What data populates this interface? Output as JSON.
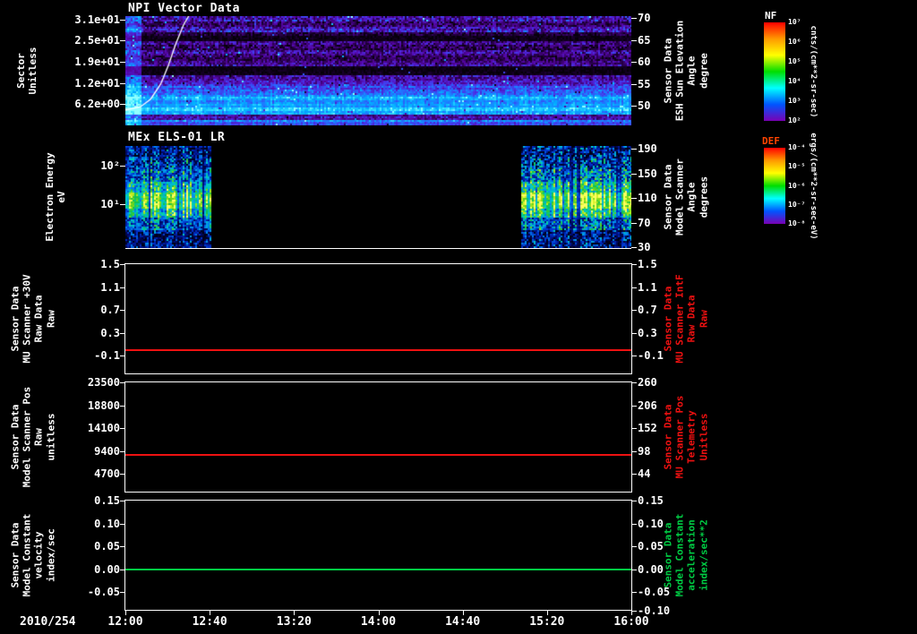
{
  "xaxis": {
    "date_label": "2010/254",
    "tick_labels": [
      "12:00",
      "12:40",
      "13:20",
      "14:00",
      "14:40",
      "15:20",
      "16:00"
    ]
  },
  "colors": {
    "axis": "#ffffff",
    "red": "#ee1111",
    "green": "#00cc44",
    "background": "#000000"
  },
  "chart_data": [
    {
      "id": "npi-vector-data",
      "type": "heatmap",
      "title": "NPI Vector Data",
      "left_label": "Sector\nUnitless",
      "left_ticks": [
        {
          "label": "3.1e+01",
          "frac": 0.031
        },
        {
          "label": "2.5e+01",
          "frac": 0.225
        },
        {
          "label": "1.9e+01",
          "frac": 0.419
        },
        {
          "label": "1.2e+01",
          "frac": 0.612
        },
        {
          "label": "6.2e+00",
          "frac": 0.806
        }
      ],
      "right_label": "Sensor Data\nESH Sun Elevation\nAngle\ndegree",
      "right_ticks": [
        {
          "label": "70",
          "frac": 0.02
        },
        {
          "label": "65",
          "frac": 0.22
        },
        {
          "label": "60",
          "frac": 0.42
        },
        {
          "label": "55",
          "frac": 0.62
        },
        {
          "label": "50",
          "frac": 0.82
        }
      ],
      "colorbar": {
        "label": "NF",
        "label_color": "#ffffff",
        "units": "cnts/(cm**2-sr-sec)",
        "ticks": [
          "10⁷",
          "10⁶",
          "10⁵",
          "10⁴",
          "10³",
          "10²"
        ],
        "stops": [
          "#ff0000",
          "#ff9900",
          "#ffff00",
          "#00dd00",
          "#00ffff",
          "#0055ff",
          "#7a00b4"
        ]
      },
      "x_range": [
        "12:00",
        "16:00"
      ],
      "overlay_curve": {
        "name": "sun-elevation-curve",
        "color": "#ffffff",
        "points": [
          [
            0.0,
            0.86
          ],
          [
            0.03,
            0.83
          ],
          [
            0.05,
            0.76
          ],
          [
            0.07,
            0.62
          ],
          [
            0.085,
            0.45
          ],
          [
            0.1,
            0.25
          ],
          [
            0.115,
            0.08
          ],
          [
            0.125,
            0.0
          ]
        ]
      },
      "stripes": [
        {
          "y0": 0.0,
          "y1": 0.045,
          "level": 0.3,
          "noise": 0.22
        },
        {
          "y0": 0.045,
          "y1": 0.09,
          "level": 0.2,
          "noise": 0.18
        },
        {
          "y0": 0.09,
          "y1": 0.135,
          "level": 0.33,
          "noise": 0.22
        },
        {
          "y0": 0.135,
          "y1": 0.175,
          "level": 0.12,
          "noise": 0.14
        },
        {
          "y0": 0.175,
          "y1": 0.215,
          "level": 0.03,
          "noise": 0.05
        },
        {
          "y0": 0.215,
          "y1": 0.26,
          "level": 0.27,
          "noise": 0.2
        },
        {
          "y0": 0.26,
          "y1": 0.31,
          "level": 0.16,
          "noise": 0.18
        },
        {
          "y0": 0.31,
          "y1": 0.36,
          "level": 0.27,
          "noise": 0.2
        },
        {
          "y0": 0.36,
          "y1": 0.405,
          "level": 0.18,
          "noise": 0.16
        },
        {
          "y0": 0.405,
          "y1": 0.445,
          "level": 0.28,
          "noise": 0.18
        },
        {
          "y0": 0.445,
          "y1": 0.525,
          "level": 0.03,
          "noise": 0.05
        },
        {
          "y0": 0.525,
          "y1": 0.575,
          "level": 0.3,
          "noise": 0.18
        },
        {
          "y0": 0.575,
          "y1": 0.625,
          "level": 0.42,
          "noise": 0.18
        },
        {
          "y0": 0.625,
          "y1": 0.675,
          "level": 0.52,
          "noise": 0.16
        },
        {
          "y0": 0.675,
          "y1": 0.73,
          "level": 0.62,
          "noise": 0.14
        },
        {
          "y0": 0.73,
          "y1": 0.79,
          "level": 0.72,
          "noise": 0.12
        },
        {
          "y0": 0.79,
          "y1": 0.86,
          "level": 0.8,
          "noise": 0.1
        },
        {
          "y0": 0.86,
          "y1": 0.9,
          "level": 0.66,
          "noise": 0.12
        },
        {
          "y0": 0.9,
          "y1": 0.935,
          "level": 0.3,
          "noise": 0.15
        },
        {
          "y0": 0.935,
          "y1": 1.01,
          "level": 0.58,
          "noise": 0.14
        }
      ]
    },
    {
      "id": "mex-els",
      "type": "heatmap",
      "title": "MEx ELS-01 LR",
      "left_label": "Electron Energy\neV",
      "left_ticks": [
        {
          "label": "10²",
          "frac": 0.19
        },
        {
          "label": "10¹",
          "frac": 0.57
        }
      ],
      "right_label": "Sensor Data\nModel Scanner\nAngle\ndegrees",
      "right_ticks": [
        {
          "label": "190",
          "frac": 0.03
        },
        {
          "label": "150",
          "frac": 0.27
        },
        {
          "label": "110",
          "frac": 0.51
        },
        {
          "label": "70",
          "frac": 0.75
        },
        {
          "label": "30",
          "frac": 0.99
        }
      ],
      "colorbar": {
        "label": "DEF",
        "label_color": "#ff4400",
        "units": "ergs/(cm**2-sr-sec-eV)",
        "ticks": [
          "10⁻⁴",
          "10⁻⁵",
          "10⁻⁶",
          "10⁻⁷",
          "10⁻⁸"
        ],
        "stops": [
          "#ff0000",
          "#ff9900",
          "#ffff00",
          "#00dd00",
          "#00ffff",
          "#0055ff",
          "#7a00b4"
        ]
      },
      "x_range": [
        "12:00",
        "16:00"
      ],
      "data_regions": [
        [
          0.0,
          0.168
        ],
        [
          0.783,
          1.0
        ]
      ],
      "profile": [
        {
          "y0": 0.0,
          "y1": 0.1,
          "level": 0.22,
          "noise": 0.28
        },
        {
          "y0": 0.1,
          "y1": 0.22,
          "level": 0.3,
          "noise": 0.3
        },
        {
          "y0": 0.22,
          "y1": 0.34,
          "level": 0.42,
          "noise": 0.28
        },
        {
          "y0": 0.34,
          "y1": 0.44,
          "level": 0.6,
          "noise": 0.22
        },
        {
          "y0": 0.44,
          "y1": 0.6,
          "level": 0.8,
          "noise": 0.16
        },
        {
          "y0": 0.6,
          "y1": 0.7,
          "level": 0.62,
          "noise": 0.22
        },
        {
          "y0": 0.7,
          "y1": 0.82,
          "level": 0.38,
          "noise": 0.28
        },
        {
          "y0": 0.82,
          "y1": 1.01,
          "level": 0.2,
          "noise": 0.25
        }
      ]
    },
    {
      "id": "mu-scanner-raw",
      "type": "line",
      "left_label": "Sensor Data\nMU Scanner +30V\nRaw Data\nRaw",
      "left_ticks": [
        {
          "label": "1.5",
          "frac": 0.0
        },
        {
          "label": "1.1",
          "frac": 0.21
        },
        {
          "label": "0.7",
          "frac": 0.42
        },
        {
          "label": "0.3",
          "frac": 0.63
        },
        {
          "label": "-0.1",
          "frac": 0.84
        }
      ],
      "right_label": "Sensor Data\nMU Scanner IntF\nRaw Data\nRaw",
      "right_label_color": "#ee1111",
      "right_ticks": [
        {
          "label": "1.5",
          "frac": 0.0
        },
        {
          "label": "1.1",
          "frac": 0.21
        },
        {
          "label": "0.7",
          "frac": 0.42
        },
        {
          "label": "0.3",
          "frac": 0.63
        },
        {
          "label": "-0.1",
          "frac": 0.84
        }
      ],
      "ylim": [
        -0.3,
        1.5
      ],
      "series": [
        {
          "name": "constant-value",
          "color": "#ee1111",
          "value": 0.0,
          "frac": 0.79
        }
      ]
    },
    {
      "id": "model-scanner-pos",
      "type": "line",
      "left_label": "Sensor Data\nModel Scanner Pos\nRaw\nunitless",
      "left_ticks": [
        {
          "label": "23500",
          "frac": 0.0
        },
        {
          "label": "18800",
          "frac": 0.21
        },
        {
          "label": "14100",
          "frac": 0.42
        },
        {
          "label": "9400",
          "frac": 0.63
        },
        {
          "label": "4700",
          "frac": 0.84
        }
      ],
      "right_label": "Sensor Data\nMU Scanner Pos\nTelemetry\nUnitless",
      "right_label_color": "#ee1111",
      "right_ticks": [
        {
          "label": "260",
          "frac": 0.0
        },
        {
          "label": "206",
          "frac": 0.21
        },
        {
          "label": "152",
          "frac": 0.42
        },
        {
          "label": "98",
          "frac": 0.63
        },
        {
          "label": "44",
          "frac": 0.84
        }
      ],
      "ylim": [
        1100,
        23500
      ],
      "series": [
        {
          "name": "constant-value",
          "color": "#ee1111",
          "value": 8800,
          "frac": 0.66
        }
      ]
    },
    {
      "id": "model-constant-velocity",
      "type": "line",
      "left_label": "Sensor Data\nModel Constant\nvelocity\nindex/sec",
      "left_ticks": [
        {
          "label": "0.15",
          "frac": 0.0
        },
        {
          "label": "0.10",
          "frac": 0.21
        },
        {
          "label": "0.05",
          "frac": 0.42
        },
        {
          "label": "0.00",
          "frac": 0.63
        },
        {
          "label": "-0.05",
          "frac": 0.84
        }
      ],
      "right_label": "Sensor Data\nModel Constant\nacceleration\nindex/sec**2",
      "right_label_color": "#00cc44",
      "right_ticks": [
        {
          "label": "0.15",
          "frac": 0.0
        },
        {
          "label": "0.10",
          "frac": 0.21
        },
        {
          "label": "0.05",
          "frac": 0.42
        },
        {
          "label": "0.00",
          "frac": 0.63
        },
        {
          "label": "-0.05",
          "frac": 0.84
        },
        {
          "label": "-0.10",
          "frac": 1.01
        }
      ],
      "ylim": [
        -0.1,
        0.15
      ],
      "series": [
        {
          "name": "constant-value",
          "color": "#00cc44",
          "value": 0.0,
          "frac": 0.63
        }
      ]
    }
  ]
}
